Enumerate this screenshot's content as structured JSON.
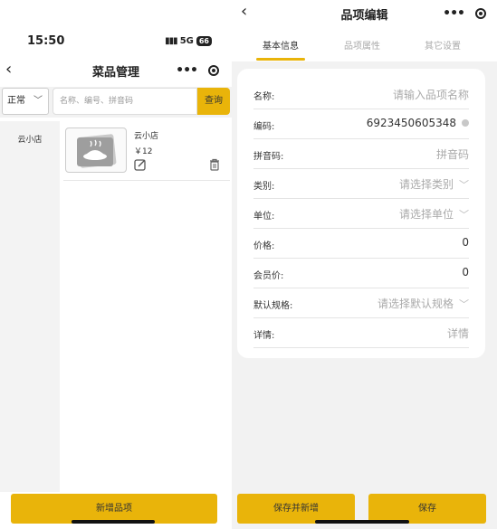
{
  "left_screen": {
    "status_bar": {
      "time": "15:50",
      "network": "5G",
      "battery": "66"
    },
    "nav": {
      "title": "菜品管理"
    },
    "filter": {
      "status_select": "正常",
      "search_placeholder": "名称、编号、拼音码",
      "query_button": "查询"
    },
    "categories": [
      {
        "label": "云小店"
      }
    ],
    "items": [
      {
        "name": "云小店",
        "price": "￥12"
      }
    ],
    "add_button": "新增品项"
  },
  "right_screen": {
    "nav": {
      "title": "品项编辑"
    },
    "tabs": [
      {
        "label": "基本信息",
        "active": true
      },
      {
        "label": "品项属性",
        "active": false
      },
      {
        "label": "其它设置",
        "active": false
      }
    ],
    "form": {
      "name_label": "名称:",
      "name_placeholder": "请输入品项名称",
      "code_label": "编码:",
      "code_value": "6923450605348",
      "pinyin_label": "拼音码:",
      "pinyin_placeholder": "拼音码",
      "category_label": "类别:",
      "category_placeholder": "请选择类别",
      "unit_label": "单位:",
      "unit_placeholder": "请选择单位",
      "price_label": "价格:",
      "price_value": "0",
      "member_price_label": "会员价:",
      "member_price_value": "0",
      "spec_label": "默认规格:",
      "spec_placeholder": "请选择默认规格",
      "detail_label": "详情:",
      "detail_placeholder": "详情"
    },
    "save_new_button": "保存并新增",
    "save_button": "保存"
  },
  "colors": {
    "accent": "#e9b40a",
    "page_bg": "#f2f2f2"
  }
}
